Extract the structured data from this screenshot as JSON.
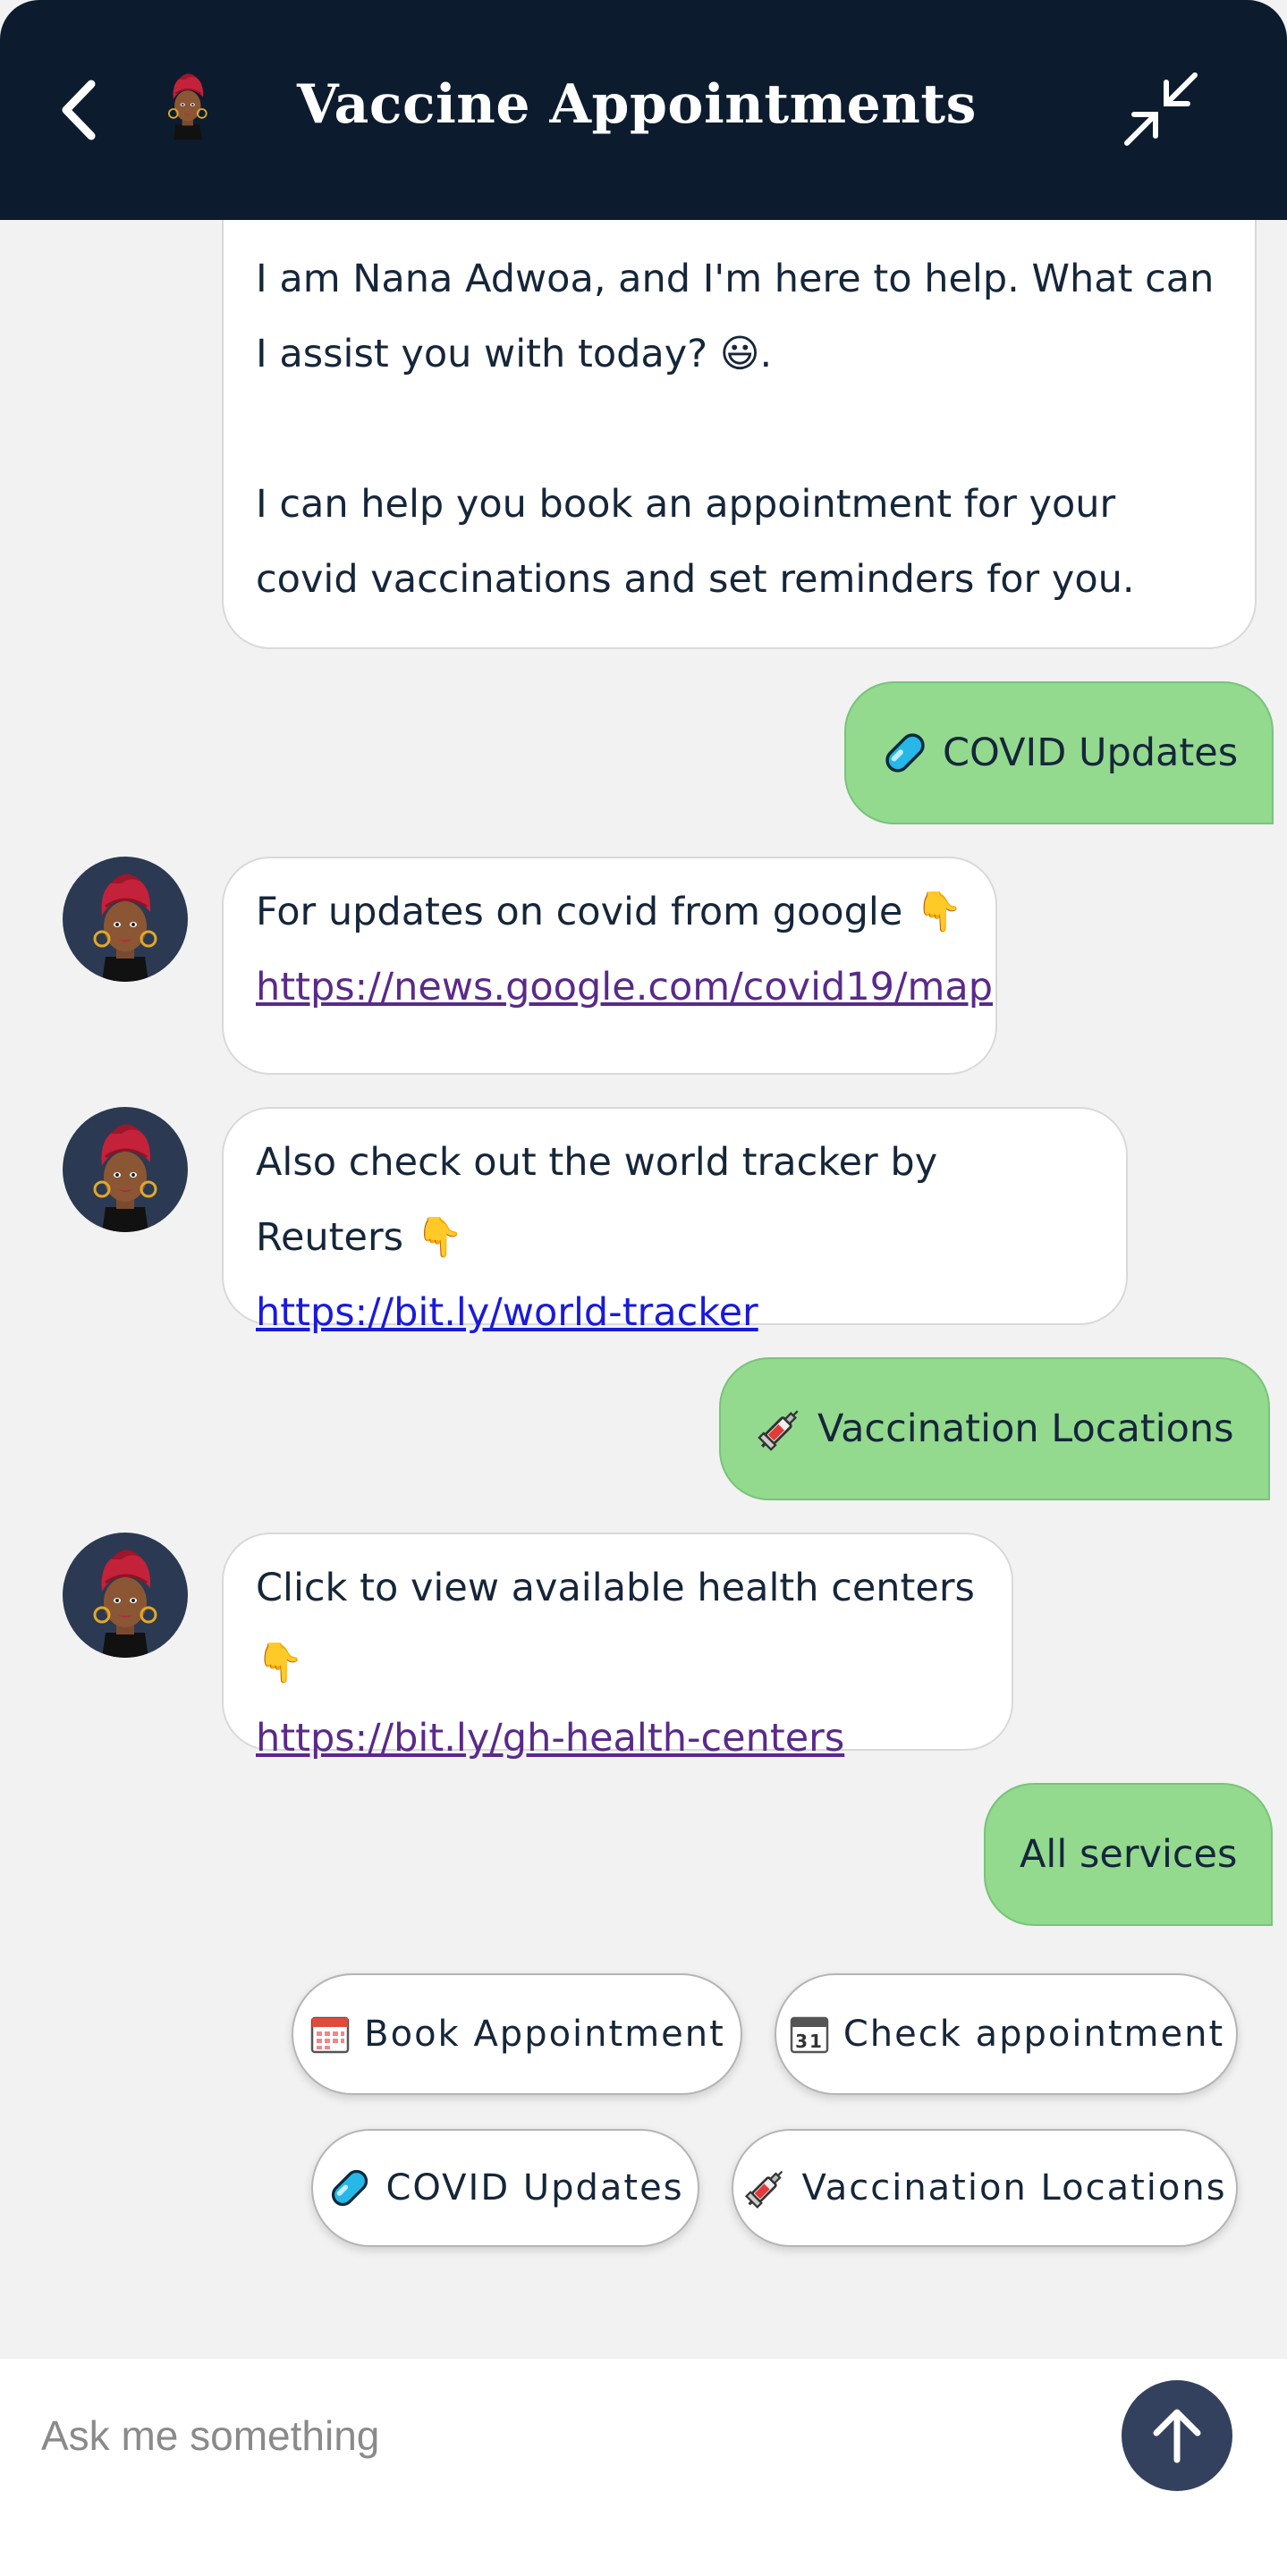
{
  "header": {
    "title": "Vaccine Appointments",
    "back_icon": "chevron-left-icon",
    "minimize_icon": "collapse-arrows-icon",
    "background_color": "#0c1c2e"
  },
  "messages": {
    "intro_line1": "I am Nana Adwoa, and I'm here to help. What can I assist you with today? 😃.",
    "intro_line2": "I can help you book an appointment for your covid vaccinations and set reminders for you.",
    "user_covid": "COVID Updates",
    "bot_google_text": "For updates on covid from google 👇",
    "bot_google_link": "https://news.google.com/covid19/map",
    "bot_reuters_text": "Also check out the world tracker by Reuters 👇",
    "bot_reuters_link": "https://bit.ly/world-tracker",
    "user_locations": "Vaccination Locations",
    "bot_centers_text": "Click to view available health centers 👇",
    "bot_centers_link": "https://bit.ly/gh-health-centers",
    "user_all": "All services"
  },
  "quick_replies": {
    "book": "Book Appointment",
    "check": "Check appointment",
    "covid": "COVID Updates",
    "locations": "Vaccination Locations"
  },
  "input": {
    "placeholder": "Ask me something",
    "value": ""
  },
  "colors": {
    "user_bubble": "#93d98e",
    "bot_bubble": "#ffffff",
    "send_button": "#34415e"
  }
}
